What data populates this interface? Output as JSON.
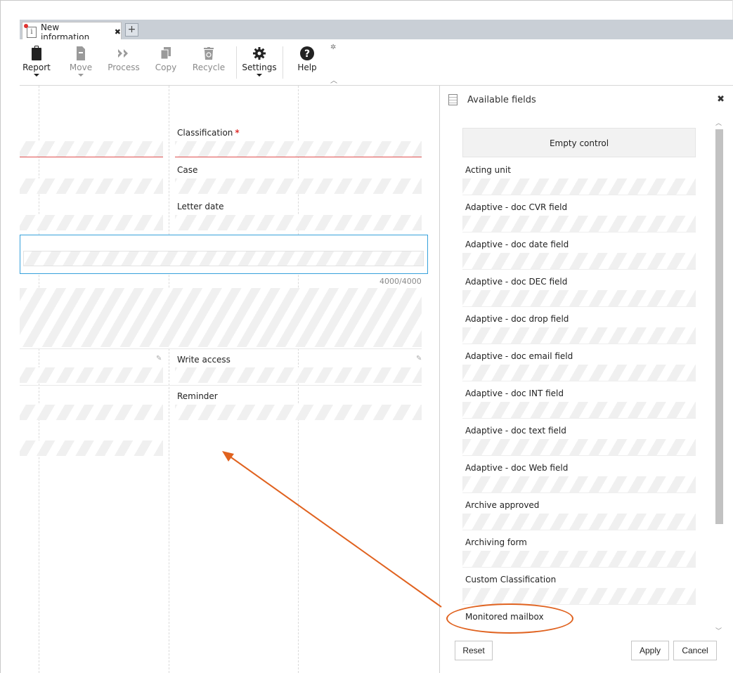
{
  "tab": {
    "title": "New information",
    "close": "✖",
    "add": "+",
    "doc_icon": "i"
  },
  "toolbar": {
    "buttons": [
      {
        "label": "Report",
        "icon": "clipboard-icon",
        "enabled": true,
        "dropdown": true
      },
      {
        "label": "Move",
        "icon": "move-icon",
        "enabled": false,
        "dropdown": true
      },
      {
        "label": "Process",
        "icon": "process-icon",
        "enabled": false,
        "dropdown": false
      },
      {
        "label": "Copy",
        "icon": "copy-icon",
        "enabled": false,
        "dropdown": false
      },
      {
        "label": "Recycle",
        "icon": "recycle-icon",
        "enabled": false,
        "dropdown": false
      },
      {
        "label": "Settings",
        "icon": "gear-icon",
        "enabled": true,
        "dropdown": true
      },
      {
        "label": "Help",
        "icon": "help-icon",
        "enabled": true,
        "dropdown": false
      }
    ]
  },
  "form": {
    "classification_label": "Classification",
    "required_mark": "*",
    "case_label": "Case",
    "letter_date_label": "Letter date",
    "counter": "4000/4000",
    "write_access_label": "Write access",
    "reminder_label": "Reminder"
  },
  "panel": {
    "title": "Available fields",
    "close": "✖",
    "empty_control": "Empty control",
    "fields": [
      "Acting unit",
      "Adaptive - doc CVR field",
      "Adaptive - doc date field",
      "Adaptive - doc DEC field",
      "Adaptive - doc drop field",
      "Adaptive - doc email field",
      "Adaptive - doc INT field",
      "Adaptive - doc text field",
      "Adaptive - doc Web field",
      "Archive approved",
      "Archiving form",
      "Custom Classification",
      "Monitored mailbox"
    ],
    "reset_label": "Reset",
    "apply_label": "Apply",
    "cancel_label": "Cancel"
  },
  "colors": {
    "accent": "#36a1db",
    "required": "#e0312f",
    "annotation": "#e0621f",
    "tabbar": "#c9cfd6"
  }
}
